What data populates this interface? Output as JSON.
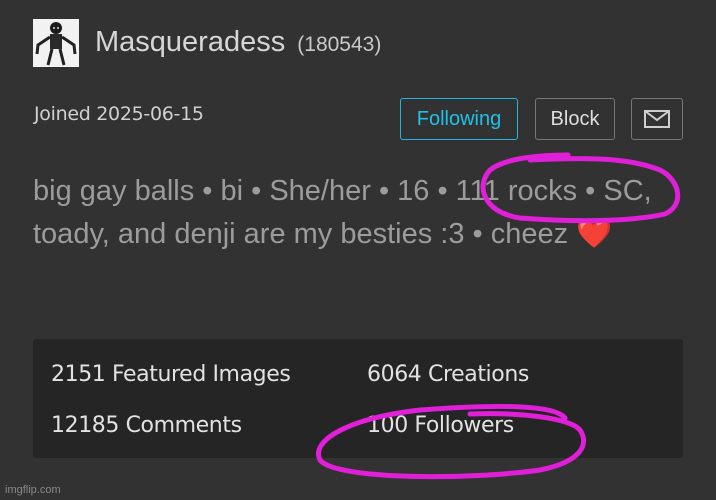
{
  "profile": {
    "username": "Masqueradess",
    "user_id": "(180543)",
    "joined": "Joined 2025-06-15",
    "avatar_icon": "animatronic-character-avatar"
  },
  "actions": {
    "following_label": "Following",
    "block_label": "Block",
    "message_icon": "envelope-icon"
  },
  "bio": {
    "text": "big gay balls • bi • She/her • 16 • 111 rocks • SC, toady, and denji are my besties :3 • cheez",
    "emoji": "❤️"
  },
  "stats": {
    "featured_images": "2151 Featured Images",
    "creations": "6064 Creations",
    "comments": "12185 Comments",
    "followers": "100 Followers"
  },
  "annotation_color": "#e020d8",
  "accent_color": "#20b8e0",
  "watermark": "imgflip.com"
}
